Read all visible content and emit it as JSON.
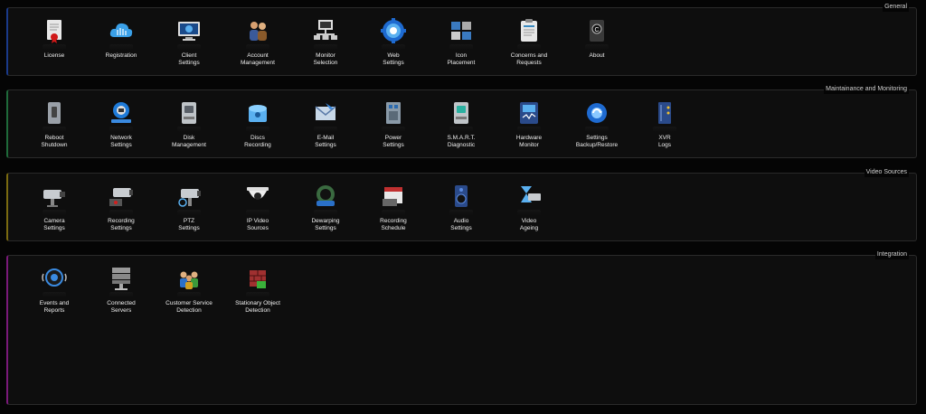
{
  "sections": {
    "general": {
      "title": "General",
      "color": "#1a3a8a",
      "items": [
        {
          "label": "License",
          "icon": "license-icon"
        },
        {
          "label": "Registration",
          "icon": "cloud-icon"
        },
        {
          "label": "Client\nSettings",
          "icon": "monitor-gear-icon"
        },
        {
          "label": "Account\nManagement",
          "icon": "users-icon"
        },
        {
          "label": "Monitor\nSelection",
          "icon": "network-monitor-icon"
        },
        {
          "label": "Web\nSettings",
          "icon": "globe-gear-icon"
        },
        {
          "label": "Icon\nPlacement",
          "icon": "camera-layout-icon"
        },
        {
          "label": "Concerns and\nRequests",
          "icon": "clipboard-icon"
        },
        {
          "label": "About",
          "icon": "info-box-icon"
        }
      ]
    },
    "maintenance": {
      "title": "Maintainance and Monitoring",
      "color": "#1f6a3a",
      "items": [
        {
          "label": "Reboot\nShutdown",
          "icon": "power-switch-icon"
        },
        {
          "label": "Network\nSettings",
          "icon": "network-icon"
        },
        {
          "label": "Disk\nManagement",
          "icon": "hard-disk-icon"
        },
        {
          "label": "Discs\nRecording",
          "icon": "disc-recording-icon"
        },
        {
          "label": "E-Mail\nSettings",
          "icon": "email-icon"
        },
        {
          "label": "Power\nSettings",
          "icon": "power-panel-icon"
        },
        {
          "label": "S.M.A.R.T.\nDiagnostic",
          "icon": "smart-disk-icon"
        },
        {
          "label": "Hardware\nMonitor",
          "icon": "hardware-monitor-icon"
        },
        {
          "label": "Settings\nBackup/Restore",
          "icon": "backup-gear-icon"
        },
        {
          "label": "XVR\nLogs",
          "icon": "logs-icon"
        }
      ]
    },
    "video": {
      "title": "Video Sources",
      "color": "#7a6a10",
      "items": [
        {
          "label": "Camera\nSettings",
          "icon": "camera-icon"
        },
        {
          "label": "Recording\nSettings",
          "icon": "recording-camera-icon"
        },
        {
          "label": "PTZ\nSettings",
          "icon": "ptz-camera-icon"
        },
        {
          "label": "IP Video\nSources",
          "icon": "dome-camera-icon"
        },
        {
          "label": "Dewarping\nSettings",
          "icon": "fisheye-camera-icon"
        },
        {
          "label": "Recording\nSchedule",
          "icon": "schedule-icon"
        },
        {
          "label": "Audio\nSettings",
          "icon": "speaker-icon"
        },
        {
          "label": "Video\nAgeing",
          "icon": "hourglass-camera-icon"
        }
      ]
    },
    "integration": {
      "title": "Integration",
      "color": "#7a1a7a",
      "items": [
        {
          "label": "Events and\nReports",
          "icon": "events-icon"
        },
        {
          "label": "Connected\nServers",
          "icon": "servers-icon"
        },
        {
          "label": "Customer Service\nDetection",
          "icon": "customers-icon"
        },
        {
          "label": "Stationary Object\nDetection",
          "icon": "brick-icon"
        }
      ]
    }
  }
}
